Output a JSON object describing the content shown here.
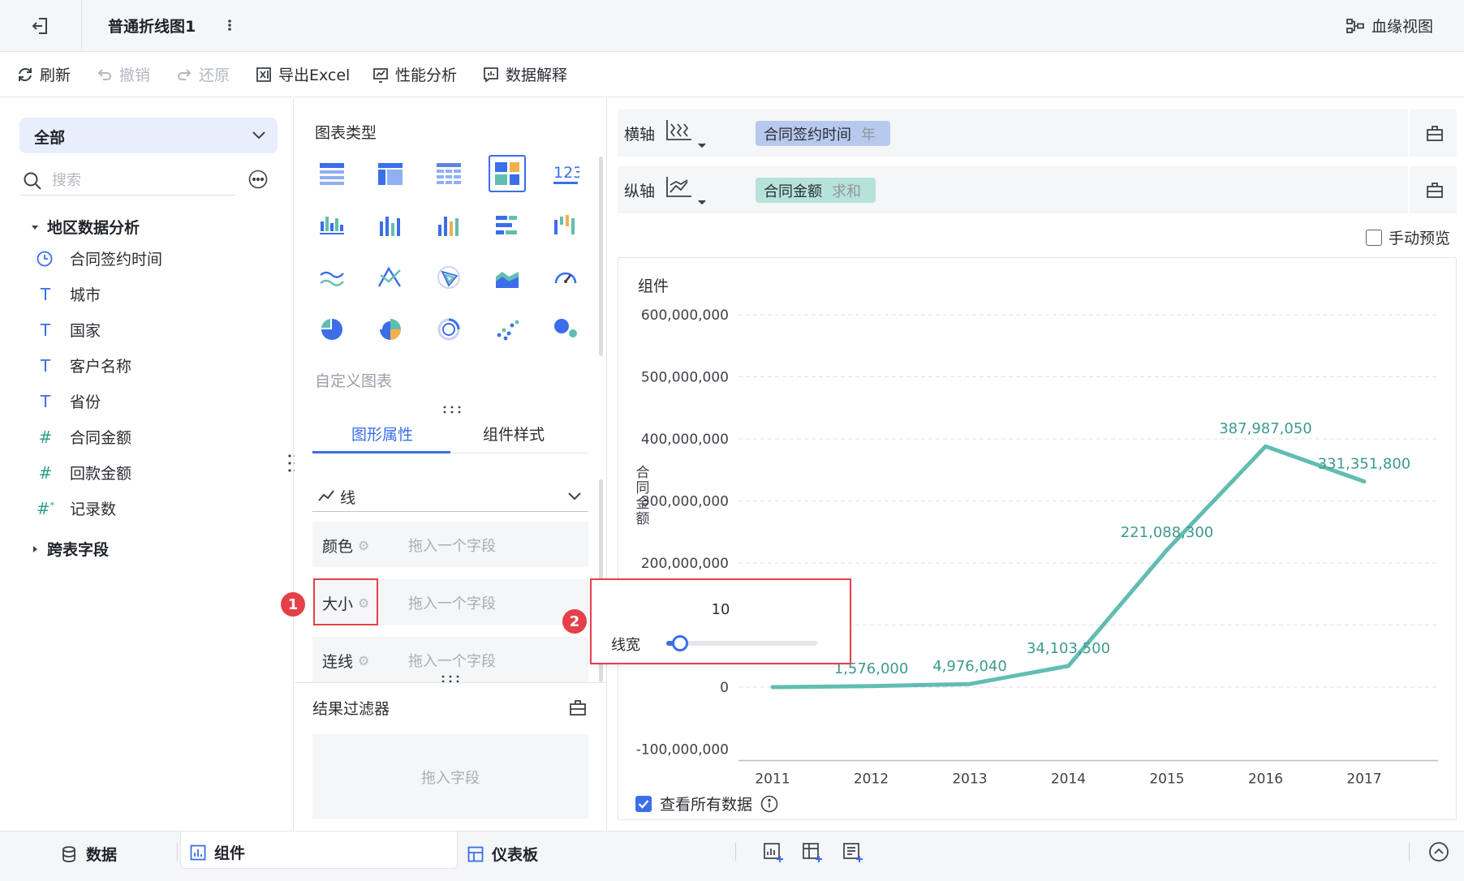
{
  "titlebar": {
    "title": "普通折线图1",
    "lineage_label": "血缘视图"
  },
  "toolbar": {
    "refresh": "刷新",
    "undo": "撤销",
    "redo": "还原",
    "export_excel": "导出Excel",
    "perf": "性能分析",
    "explain": "数据解释"
  },
  "fields": {
    "scope": "全部",
    "search_placeholder": "搜索",
    "group_name": "地区数据分析",
    "items": [
      {
        "type": "date",
        "label": "合同签约时间"
      },
      {
        "type": "text",
        "label": "城市"
      },
      {
        "type": "text",
        "label": "国家"
      },
      {
        "type": "text",
        "label": "客户名称"
      },
      {
        "type": "text",
        "label": "省份"
      },
      {
        "type": "number",
        "label": "合同金额"
      },
      {
        "type": "number",
        "label": "回款金额"
      },
      {
        "type": "count",
        "label": "记录数"
      }
    ],
    "cross_table": "跨表字段"
  },
  "config": {
    "chart_type_title": "图表类型",
    "custom_chart": "自定义图表",
    "tab_graphic": "图形属性",
    "tab_style": "组件样式",
    "mark_type": "线",
    "props": [
      {
        "name": "颜色",
        "placeholder": "拖入一个字段"
      },
      {
        "name": "大小",
        "placeholder": "拖入一个字段"
      },
      {
        "name": "连线",
        "placeholder": "拖入一个字段"
      }
    ],
    "filter_title": "结果过滤器",
    "filter_placeholder": "拖入字段"
  },
  "axes": {
    "x_label": "横轴",
    "x_field": "合同签约时间",
    "x_agg": "年",
    "y_label": "纵轴",
    "y_field": "合同金额",
    "y_agg": "求和",
    "manual_preview": "手动预览"
  },
  "chart_data": {
    "type": "line",
    "title": "组件",
    "ylabel": "合同金额",
    "xlabel": "",
    "categories": [
      "2011",
      "2012",
      "2013",
      "2014",
      "2015",
      "2016",
      "2017"
    ],
    "values": [
      0,
      1576000,
      4976040,
      34103500,
      221088300,
      387987050,
      331351800
    ],
    "data_labels": [
      "",
      "1,576,000",
      "4,976,040",
      "34,103,500",
      "221,088,300",
      "387,987,050",
      "331,351,800"
    ],
    "yticks": [
      -100000000,
      0,
      100000000,
      200000000,
      300000000,
      400000000,
      500000000,
      600000000
    ],
    "ytick_labels": [
      "-100,000,000",
      "0",
      "",
      "200,000,000",
      "300,000,000",
      "400,000,000",
      "500,000,000",
      "600,000,000"
    ],
    "ylim": [
      -100000000,
      600000000
    ],
    "grid": true,
    "color": "#62bdb1"
  },
  "chart_footer": {
    "view_all": "查看所有数据"
  },
  "popup": {
    "value": "10",
    "label": "线宽",
    "fraction": 0.09
  },
  "badges": {
    "one": "1",
    "two": "2"
  },
  "bottom": {
    "data": "数据",
    "component": "组件",
    "dashboard": "仪表板"
  },
  "colors": {
    "accent": "#3b6ee8",
    "highlight": "#e5404a",
    "x_pill": "#b8c9ee",
    "y_pill": "#b6e2da"
  }
}
